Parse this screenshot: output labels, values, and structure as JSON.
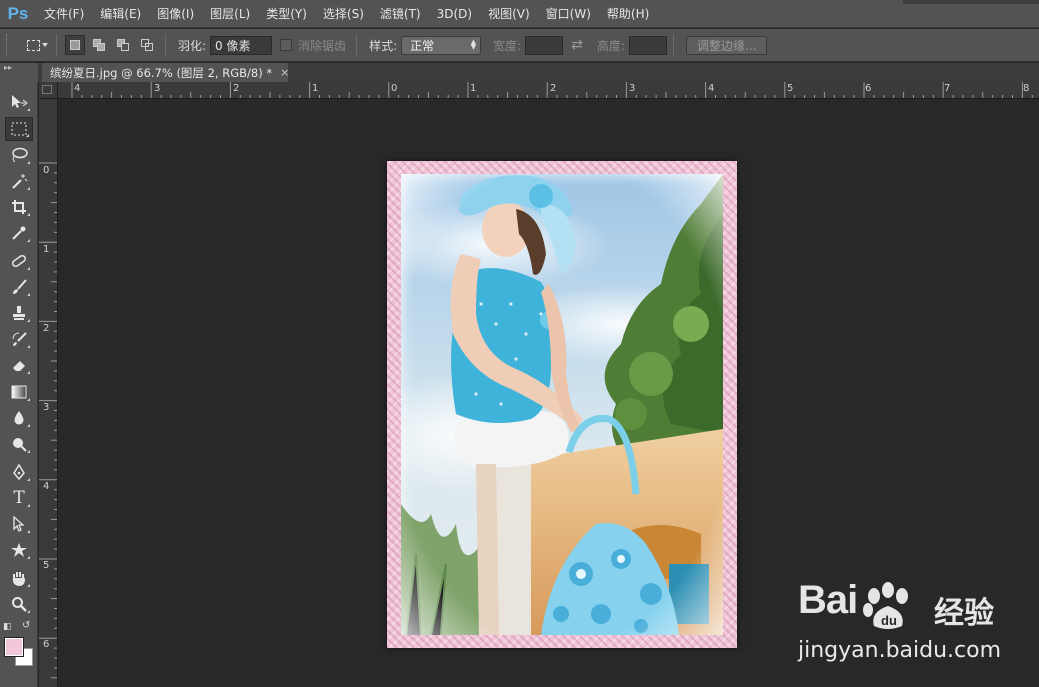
{
  "app": {
    "logo": "Ps"
  },
  "menu": [
    "文件(F)",
    "编辑(E)",
    "图像(I)",
    "图层(L)",
    "类型(Y)",
    "选择(S)",
    "滤镜(T)",
    "3D(D)",
    "视图(V)",
    "窗口(W)",
    "帮助(H)"
  ],
  "options": {
    "feather_label": "羽化:",
    "feather_value": "0 像素",
    "antialias_label": "消除锯齿",
    "style_label": "样式:",
    "style_value": "正常",
    "width_label": "宽度:",
    "height_label": "高度:",
    "refine_button": "调整边缘..."
  },
  "document_tab": {
    "title": "缤纷夏日.jpg @ 66.7% (图层 2, RGB/8) *",
    "close": "×"
  },
  "ruler": {
    "top_labels": [
      "4",
      "3",
      "2",
      "1",
      "0",
      "1",
      "2",
      "3",
      "4",
      "5",
      "6",
      "7",
      "8"
    ],
    "left_labels": [
      "0",
      "1",
      "2",
      "3",
      "4",
      "5",
      "6"
    ]
  },
  "colors": {
    "foreground": "#f4c6da",
    "background": "#ffffff",
    "frame": "#f2c4d8"
  },
  "tools": [
    "move-tool",
    "marquee-tool",
    "lasso-tool",
    "magic-wand-tool",
    "crop-tool",
    "eyedropper-tool",
    "healing-brush-tool",
    "brush-tool",
    "clone-stamp-tool",
    "history-brush-tool",
    "eraser-tool",
    "gradient-tool",
    "blur-tool",
    "dodge-tool",
    "pen-tool",
    "type-tool",
    "path-selection-tool",
    "shape-tool",
    "hand-tool",
    "zoom-tool"
  ],
  "watermark": {
    "brand_left": "Bai",
    "brand_right": "经验",
    "url": "jingyan.baidu.com"
  }
}
